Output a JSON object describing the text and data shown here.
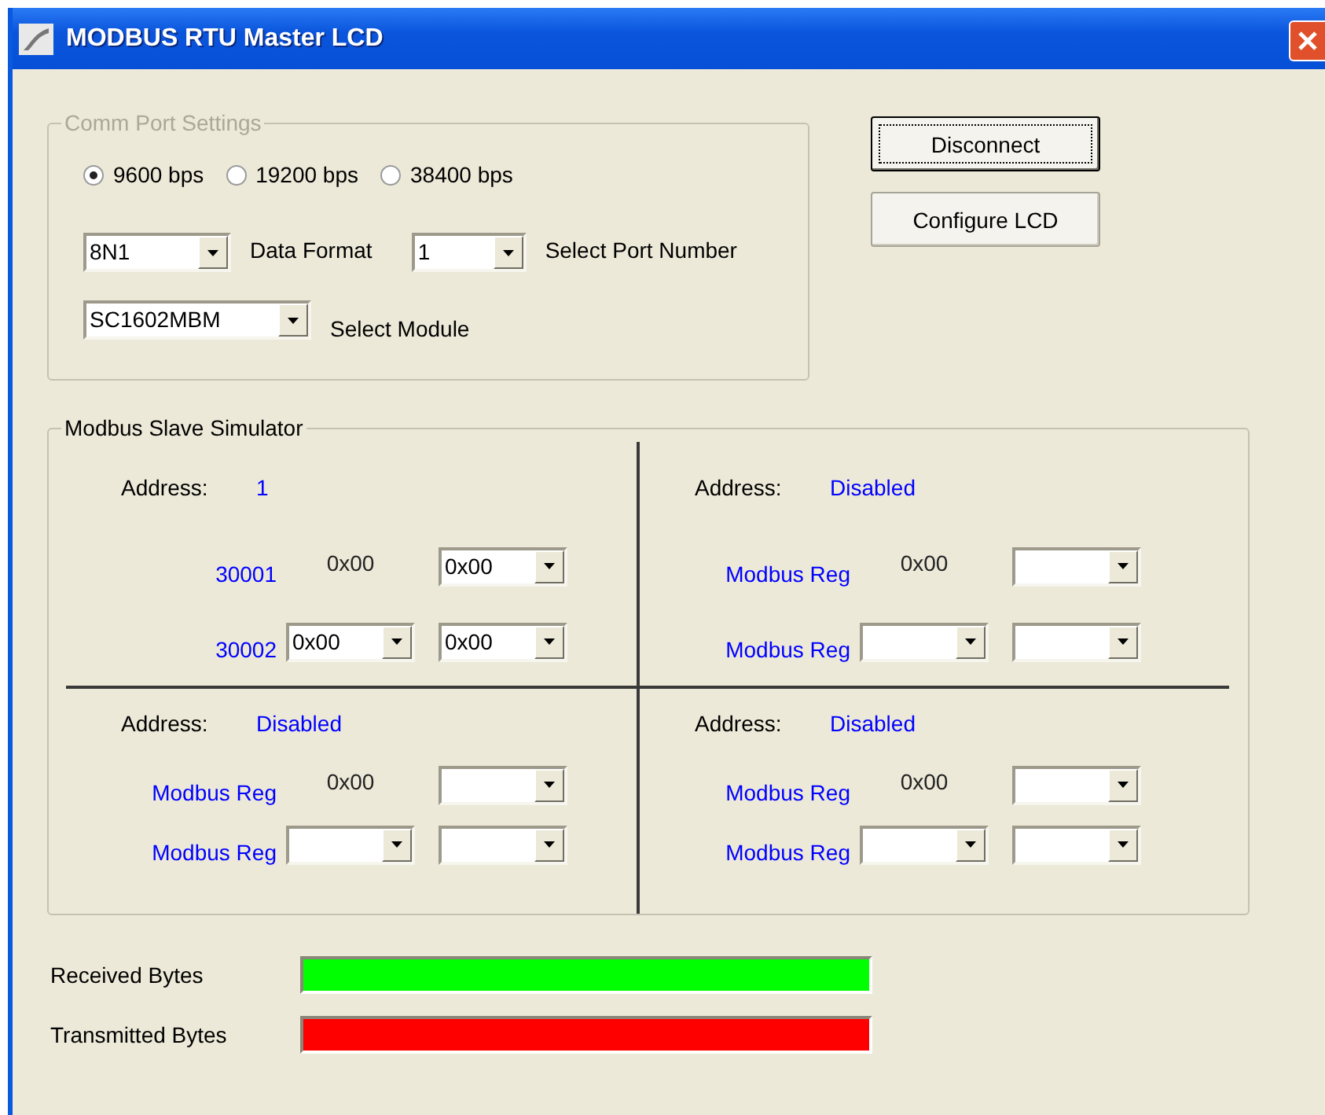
{
  "window": {
    "title": "MODBUS RTU Master LCD"
  },
  "comm_port_settings": {
    "title": "Comm Port Settings",
    "baud_rates": [
      {
        "label": "9600 bps",
        "selected": true
      },
      {
        "label": "19200 bps",
        "selected": false
      },
      {
        "label": "38400 bps",
        "selected": false
      }
    ],
    "data_format": {
      "value": "8N1",
      "label": "Data Format"
    },
    "port_number": {
      "value": "1",
      "label": "Select Port Number"
    },
    "module": {
      "value": "SC1602MBM",
      "label": "Select Module"
    }
  },
  "buttons": [
    {
      "label": "Disconnect",
      "focused": true
    },
    {
      "label": "Configure LCD",
      "focused": false
    }
  ],
  "slave_simulator": {
    "title": "Modbus Slave Simulator",
    "slaves": [
      {
        "address_label": "Address:",
        "address": "1",
        "rows": [
          {
            "register": "30001",
            "reading": "0x00",
            "selects": [
              {
                "kind": "filled",
                "value": "0x00"
              }
            ]
          },
          {
            "register": "30002",
            "selects": [
              {
                "kind": "filled",
                "value": "0x00"
              },
              {
                "kind": "filled",
                "value": "0x00"
              }
            ]
          }
        ]
      },
      {
        "address_label": "Address:",
        "address": "Disabled",
        "rows": [
          {
            "register": "Modbus Reg",
            "reading": "0x00",
            "selects": [
              {
                "kind": "empty"
              }
            ]
          },
          {
            "register": "Modbus Reg",
            "selects": [
              {
                "kind": "empty"
              },
              {
                "kind": "empty"
              }
            ]
          }
        ]
      },
      {
        "address_label": "Address:",
        "address": "Disabled",
        "rows": [
          {
            "register": "Modbus Reg",
            "reading": "0x00",
            "selects": [
              {
                "kind": "empty"
              }
            ]
          },
          {
            "register": "Modbus Reg",
            "selects": [
              {
                "kind": "empty"
              },
              {
                "kind": "empty"
              }
            ]
          }
        ]
      },
      {
        "address_label": "Address:",
        "address": "Disabled",
        "rows": [
          {
            "register": "Modbus Reg",
            "reading": "0x00",
            "selects": [
              {
                "kind": "empty"
              }
            ]
          },
          {
            "register": "Modbus Reg",
            "selects": [
              {
                "kind": "empty"
              },
              {
                "kind": "empty"
              }
            ]
          }
        ]
      }
    ]
  },
  "indicators": [
    {
      "label": "Received Bytes",
      "level": 1,
      "color": "#00ff00"
    },
    {
      "label": "Transmitted Bytes",
      "level": 1,
      "color": "#ff0000"
    }
  ]
}
